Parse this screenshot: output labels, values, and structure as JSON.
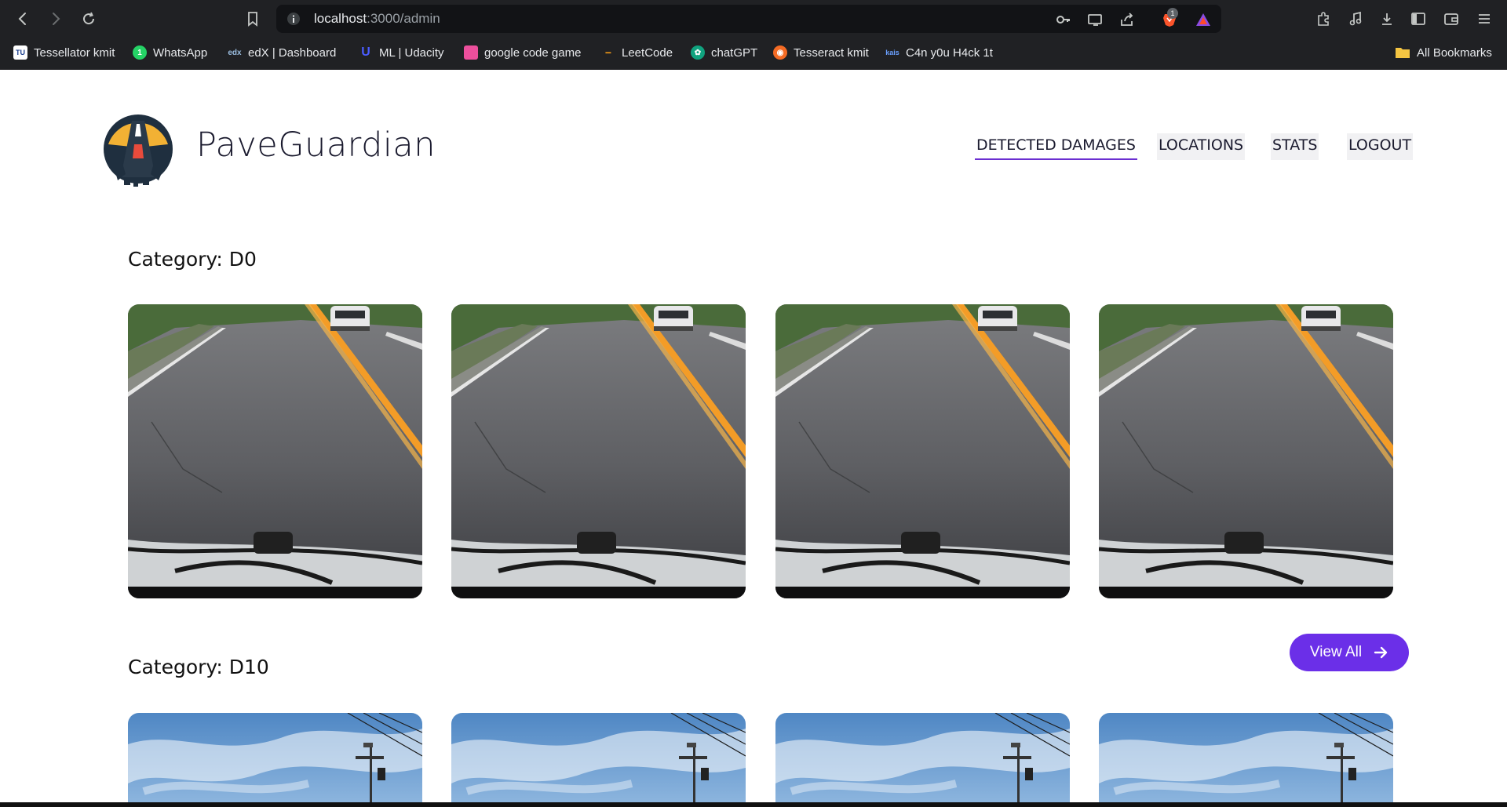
{
  "browser": {
    "url_host": "localhost",
    "url_path": ":3000/admin",
    "extension_badge": "1",
    "bookmarks": [
      {
        "label": "Tessellator kmit",
        "icon": "tu-favicon"
      },
      {
        "label": "WhatsApp",
        "icon": "whatsapp-favicon"
      },
      {
        "label": "edX  | Dashboard",
        "icon": "edx-favicon"
      },
      {
        "label": "ML | Udacity",
        "icon": "udacity-favicon"
      },
      {
        "label": "google code game",
        "icon": "pink-square-favicon"
      },
      {
        "label": "LeetCode",
        "icon": "leetcode-favicon"
      },
      {
        "label": "chatGPT",
        "icon": "chatgpt-favicon"
      },
      {
        "label": "Tesseract kmit",
        "icon": "tesseract-favicon"
      },
      {
        "label": "C4n y0u H4ck 1t",
        "icon": "kmit-favicon"
      }
    ],
    "all_bookmarks": "All Bookmarks"
  },
  "header": {
    "brand": "PaveGuardian",
    "nav": [
      {
        "label": "DETECTED DAMAGES",
        "active": true
      },
      {
        "label": "LOCATIONS",
        "active": false
      },
      {
        "label": "STATS",
        "active": false
      },
      {
        "label": "LOGOUT",
        "active": false
      }
    ]
  },
  "categories": [
    {
      "title": "Category: D0"
    },
    {
      "title": "Category: D10"
    }
  ],
  "view_all": "View All",
  "colors": {
    "accent": "#6b2fe8",
    "nav_underline": "#6b2fd1",
    "chrome_bg": "#202124"
  }
}
